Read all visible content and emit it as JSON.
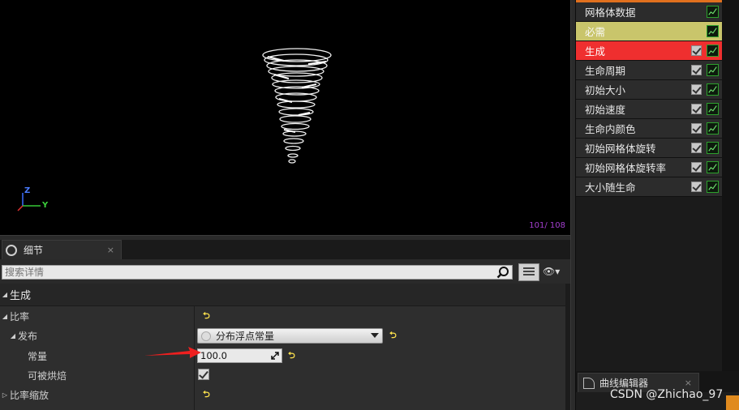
{
  "viewport": {
    "particle_count": "101/ 108",
    "axis": {
      "z_label": "Z",
      "y_label": "Y"
    }
  },
  "modules": [
    {
      "label": "网格体数据",
      "state": "normal",
      "has_checkbox": false
    },
    {
      "label": "必需",
      "state": "required",
      "has_checkbox": false
    },
    {
      "label": "生成",
      "state": "spawn",
      "has_checkbox": true
    },
    {
      "label": "生命周期",
      "state": "normal",
      "has_checkbox": true
    },
    {
      "label": "初始大小",
      "state": "normal",
      "has_checkbox": true
    },
    {
      "label": "初始速度",
      "state": "normal",
      "has_checkbox": true
    },
    {
      "label": "生命内颜色",
      "state": "normal",
      "has_checkbox": true
    },
    {
      "label": "初始网格体旋转",
      "state": "normal",
      "has_checkbox": true
    },
    {
      "label": "初始网格体旋转率",
      "state": "normal",
      "has_checkbox": true
    },
    {
      "label": "大小随生命",
      "state": "normal",
      "has_checkbox": true
    }
  ],
  "curve_editor": {
    "tab_label": "曲线编辑器",
    "close": "×"
  },
  "details": {
    "tab_label": "细节",
    "close": "×",
    "search_placeholder": "搜索详情",
    "eye": "👁▾",
    "category": "生成",
    "rows": {
      "rate": "比率",
      "distribution": "发布",
      "constant": "常量",
      "bakeable": "可被烘焙",
      "rate_scale": "比率缩放"
    },
    "distribution_value": "分布浮点常量",
    "constant_value": "100.0",
    "bakeable_checked": true
  },
  "watermark": "CSDN @Zhichao_97",
  "colors": {
    "required": "#c9c56b",
    "spawn": "#ef2f2f",
    "accent": "#e0701e",
    "counter": "#a43fd0"
  }
}
